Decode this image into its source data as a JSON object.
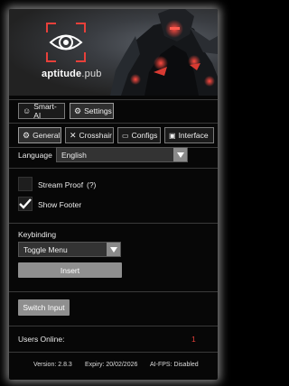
{
  "brand": {
    "name_main": "aptitude",
    "name_suffix": ".pub"
  },
  "top_tabs": [
    {
      "label": "Smart-AI",
      "icon": "brain-icon"
    },
    {
      "label": "Settings",
      "icon": "gear-icon"
    }
  ],
  "sub_tabs": [
    {
      "label": "General",
      "icon": "gear-icon"
    },
    {
      "label": "Crosshair",
      "icon": "crosshair-icon"
    },
    {
      "label": "Configs",
      "icon": "folder-icon"
    },
    {
      "label": "Interface",
      "icon": "window-icon"
    }
  ],
  "language": {
    "label": "Language",
    "value": "English"
  },
  "stream_proof": {
    "label": "Stream Proof",
    "help": "(?)",
    "checked": false
  },
  "show_footer": {
    "label": "Show Footer",
    "checked": true
  },
  "keybinding": {
    "label": "Keybinding",
    "value": "Toggle Menu",
    "insert_label": "Insert"
  },
  "switch_input": {
    "label": "Switch Input"
  },
  "users_online": {
    "label": "Users Online:",
    "value": "1"
  },
  "footer": {
    "version": "Version: 2.8.3",
    "expiry": "Expiry: 20/02/2026",
    "fps": "AI-FPS: Disabled"
  },
  "colors": {
    "accent": "#e8403a",
    "button": "#8f8f8f",
    "panel": "#070707"
  }
}
